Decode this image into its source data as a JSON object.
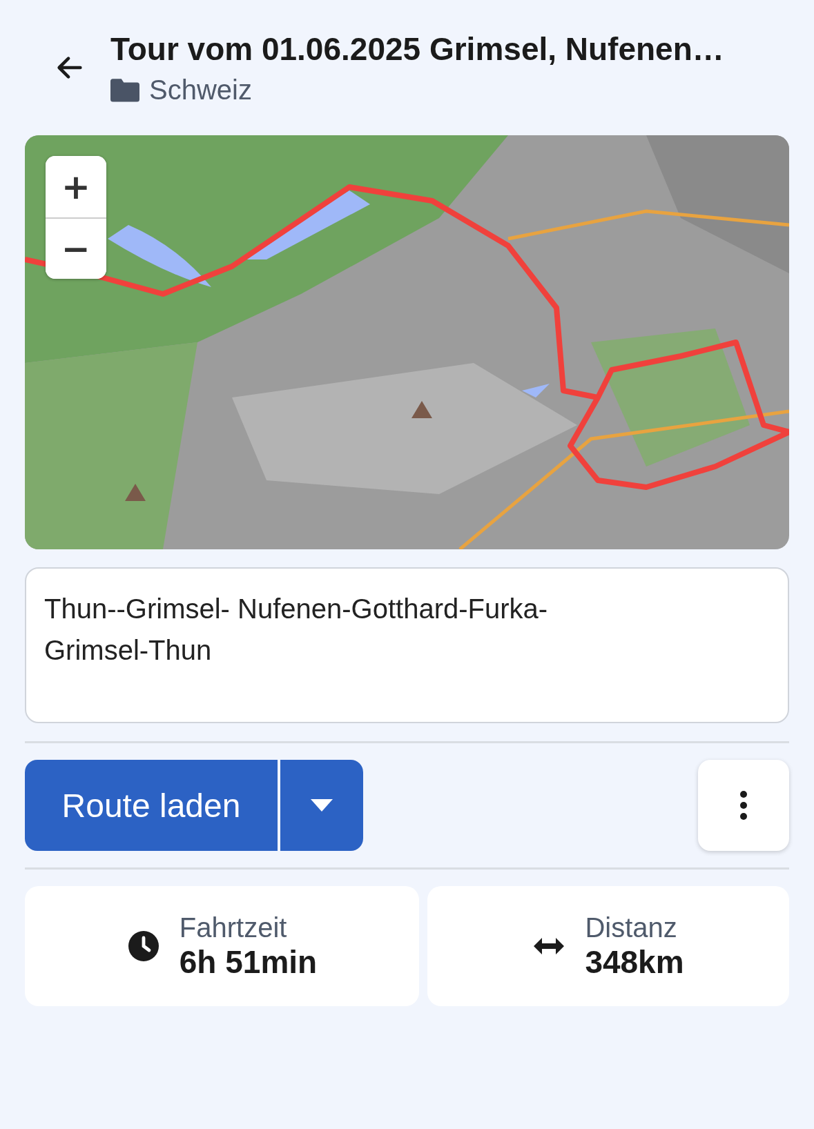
{
  "header": {
    "title": "Tour vom 01.06.2025 Grimsel, Nufenen…",
    "folder": "Schweiz"
  },
  "map": {
    "kind": "picture",
    "zoom_in": "+",
    "zoom_out": "−"
  },
  "description": {
    "value": "Thun--Grimsel- Nufenen-Gotthard-Furka-Grimsel-Thun"
  },
  "actions": {
    "primary": "Route laden"
  },
  "stats": [
    {
      "kind": "time",
      "label": "Fahrtzeit",
      "value": "6h 51min"
    },
    {
      "kind": "distance",
      "label": "Distanz",
      "value": "348km"
    }
  ]
}
